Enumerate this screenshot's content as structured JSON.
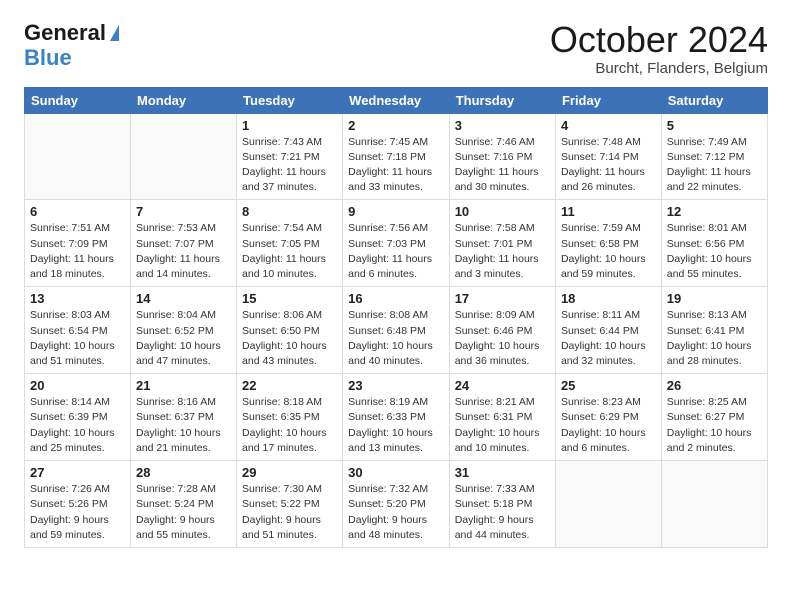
{
  "logo": {
    "general": "General",
    "blue": "Blue"
  },
  "title": "October 2024",
  "subtitle": "Burcht, Flanders, Belgium",
  "days_header": [
    "Sunday",
    "Monday",
    "Tuesday",
    "Wednesday",
    "Thursday",
    "Friday",
    "Saturday"
  ],
  "weeks": [
    [
      {
        "num": "",
        "detail": ""
      },
      {
        "num": "",
        "detail": ""
      },
      {
        "num": "1",
        "detail": "Sunrise: 7:43 AM\nSunset: 7:21 PM\nDaylight: 11 hours\nand 37 minutes."
      },
      {
        "num": "2",
        "detail": "Sunrise: 7:45 AM\nSunset: 7:18 PM\nDaylight: 11 hours\nand 33 minutes."
      },
      {
        "num": "3",
        "detail": "Sunrise: 7:46 AM\nSunset: 7:16 PM\nDaylight: 11 hours\nand 30 minutes."
      },
      {
        "num": "4",
        "detail": "Sunrise: 7:48 AM\nSunset: 7:14 PM\nDaylight: 11 hours\nand 26 minutes."
      },
      {
        "num": "5",
        "detail": "Sunrise: 7:49 AM\nSunset: 7:12 PM\nDaylight: 11 hours\nand 22 minutes."
      }
    ],
    [
      {
        "num": "6",
        "detail": "Sunrise: 7:51 AM\nSunset: 7:09 PM\nDaylight: 11 hours\nand 18 minutes."
      },
      {
        "num": "7",
        "detail": "Sunrise: 7:53 AM\nSunset: 7:07 PM\nDaylight: 11 hours\nand 14 minutes."
      },
      {
        "num": "8",
        "detail": "Sunrise: 7:54 AM\nSunset: 7:05 PM\nDaylight: 11 hours\nand 10 minutes."
      },
      {
        "num": "9",
        "detail": "Sunrise: 7:56 AM\nSunset: 7:03 PM\nDaylight: 11 hours\nand 6 minutes."
      },
      {
        "num": "10",
        "detail": "Sunrise: 7:58 AM\nSunset: 7:01 PM\nDaylight: 11 hours\nand 3 minutes."
      },
      {
        "num": "11",
        "detail": "Sunrise: 7:59 AM\nSunset: 6:58 PM\nDaylight: 10 hours\nand 59 minutes."
      },
      {
        "num": "12",
        "detail": "Sunrise: 8:01 AM\nSunset: 6:56 PM\nDaylight: 10 hours\nand 55 minutes."
      }
    ],
    [
      {
        "num": "13",
        "detail": "Sunrise: 8:03 AM\nSunset: 6:54 PM\nDaylight: 10 hours\nand 51 minutes."
      },
      {
        "num": "14",
        "detail": "Sunrise: 8:04 AM\nSunset: 6:52 PM\nDaylight: 10 hours\nand 47 minutes."
      },
      {
        "num": "15",
        "detail": "Sunrise: 8:06 AM\nSunset: 6:50 PM\nDaylight: 10 hours\nand 43 minutes."
      },
      {
        "num": "16",
        "detail": "Sunrise: 8:08 AM\nSunset: 6:48 PM\nDaylight: 10 hours\nand 40 minutes."
      },
      {
        "num": "17",
        "detail": "Sunrise: 8:09 AM\nSunset: 6:46 PM\nDaylight: 10 hours\nand 36 minutes."
      },
      {
        "num": "18",
        "detail": "Sunrise: 8:11 AM\nSunset: 6:44 PM\nDaylight: 10 hours\nand 32 minutes."
      },
      {
        "num": "19",
        "detail": "Sunrise: 8:13 AM\nSunset: 6:41 PM\nDaylight: 10 hours\nand 28 minutes."
      }
    ],
    [
      {
        "num": "20",
        "detail": "Sunrise: 8:14 AM\nSunset: 6:39 PM\nDaylight: 10 hours\nand 25 minutes."
      },
      {
        "num": "21",
        "detail": "Sunrise: 8:16 AM\nSunset: 6:37 PM\nDaylight: 10 hours\nand 21 minutes."
      },
      {
        "num": "22",
        "detail": "Sunrise: 8:18 AM\nSunset: 6:35 PM\nDaylight: 10 hours\nand 17 minutes."
      },
      {
        "num": "23",
        "detail": "Sunrise: 8:19 AM\nSunset: 6:33 PM\nDaylight: 10 hours\nand 13 minutes."
      },
      {
        "num": "24",
        "detail": "Sunrise: 8:21 AM\nSunset: 6:31 PM\nDaylight: 10 hours\nand 10 minutes."
      },
      {
        "num": "25",
        "detail": "Sunrise: 8:23 AM\nSunset: 6:29 PM\nDaylight: 10 hours\nand 6 minutes."
      },
      {
        "num": "26",
        "detail": "Sunrise: 8:25 AM\nSunset: 6:27 PM\nDaylight: 10 hours\nand 2 minutes."
      }
    ],
    [
      {
        "num": "27",
        "detail": "Sunrise: 7:26 AM\nSunset: 5:26 PM\nDaylight: 9 hours\nand 59 minutes."
      },
      {
        "num": "28",
        "detail": "Sunrise: 7:28 AM\nSunset: 5:24 PM\nDaylight: 9 hours\nand 55 minutes."
      },
      {
        "num": "29",
        "detail": "Sunrise: 7:30 AM\nSunset: 5:22 PM\nDaylight: 9 hours\nand 51 minutes."
      },
      {
        "num": "30",
        "detail": "Sunrise: 7:32 AM\nSunset: 5:20 PM\nDaylight: 9 hours\nand 48 minutes."
      },
      {
        "num": "31",
        "detail": "Sunrise: 7:33 AM\nSunset: 5:18 PM\nDaylight: 9 hours\nand 44 minutes."
      },
      {
        "num": "",
        "detail": ""
      },
      {
        "num": "",
        "detail": ""
      }
    ]
  ]
}
